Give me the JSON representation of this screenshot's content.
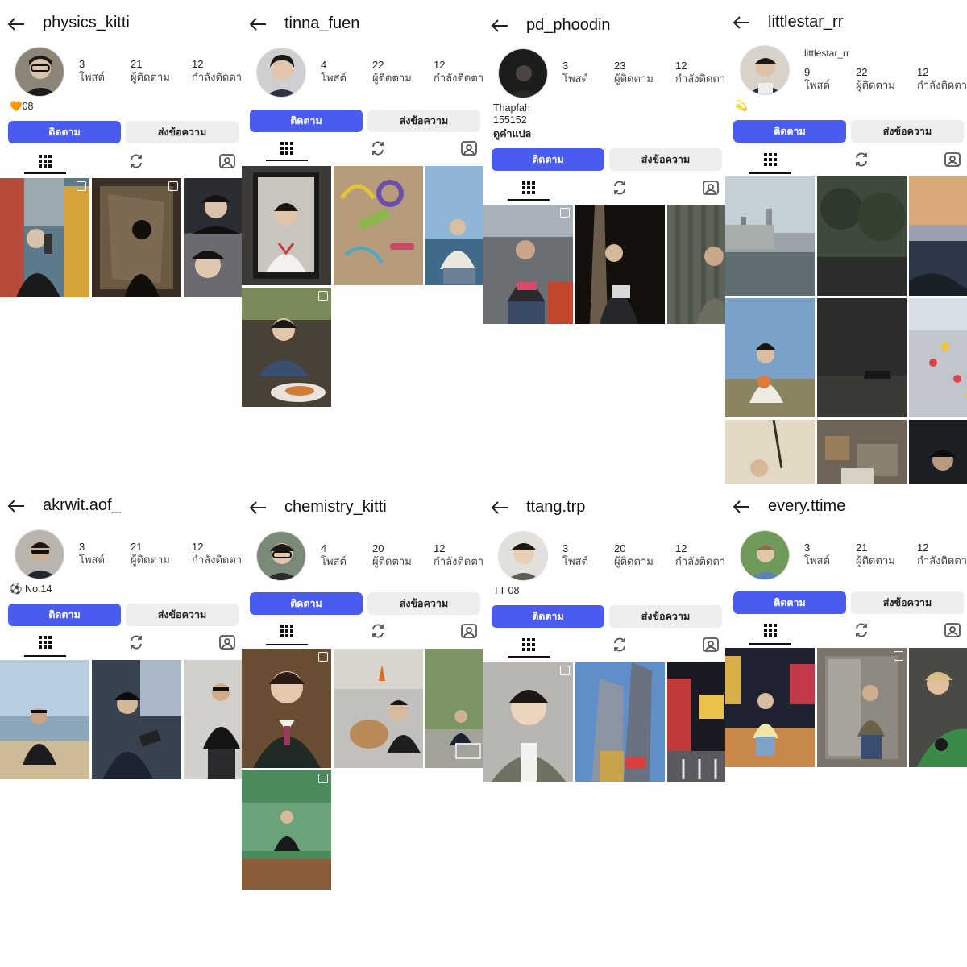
{
  "common": {
    "follow_label": "ติดตาม",
    "message_label": "ส่งข้อความ",
    "accent_color": "#4a5cf0",
    "icons": [
      "back-arrow-icon",
      "grid-icon",
      "repost-icon",
      "tagged-icon",
      "multi-image-icon"
    ]
  },
  "profiles": [
    {
      "username": "physics_kitti",
      "posts": "3",
      "posts_label": "โพสต์",
      "followers": "21",
      "followers_label": "ผู้ติดตาม",
      "following": "12",
      "following_label": "กำลังติดตาม",
      "bio": "🧡08"
    },
    {
      "username": "tinna_fuen",
      "posts": "4",
      "posts_label": "โพสต์",
      "followers": "22",
      "followers_label": "ผู้ติดตาม",
      "following": "12",
      "following_label": "กำลังติดตาม",
      "bio": ""
    },
    {
      "username": "pd_phoodin",
      "posts": "3",
      "posts_label": "โพสต์",
      "followers": "23",
      "followers_label": "ผู้ติดตาม",
      "following": "12",
      "following_label": "กำลังติดตาม",
      "bio": "Thapfah\n155152",
      "bio_link": "ดูคำแปล"
    },
    {
      "username": "littlestar_rr",
      "display_name": "littlestar_rr",
      "posts": "9",
      "posts_label": "โพสต์",
      "followers": "22",
      "followers_label": "ผู้ติดตาม",
      "following": "12",
      "following_label": "กำลังติดตาม",
      "bio": "💫"
    },
    {
      "username": "akrwit.aof_",
      "posts": "3",
      "posts_label": "โพสต์",
      "followers": "21",
      "followers_label": "ผู้ติดตาม",
      "following": "12",
      "following_label": "กำลังติดตาม",
      "bio": "⚽ No.14"
    },
    {
      "username": "chemistry_kitti",
      "posts": "4",
      "posts_label": "โพสต์",
      "followers": "20",
      "followers_label": "ผู้ติดตาม",
      "following": "12",
      "following_label": "กำลังติดตาม",
      "bio": ""
    },
    {
      "username": "ttang.trp",
      "posts": "3",
      "posts_label": "โพสต์",
      "followers": "20",
      "followers_label": "ผู้ติดตาม",
      "following": "12",
      "following_label": "กำลังติดตาม",
      "bio": "TT 08"
    },
    {
      "username": "every.ttime",
      "posts": "3",
      "posts_label": "โพสต์",
      "followers": "21",
      "followers_label": "ผู้ติดตาม",
      "following": "12",
      "following_label": "กำลังติดตาม",
      "bio": ""
    }
  ]
}
